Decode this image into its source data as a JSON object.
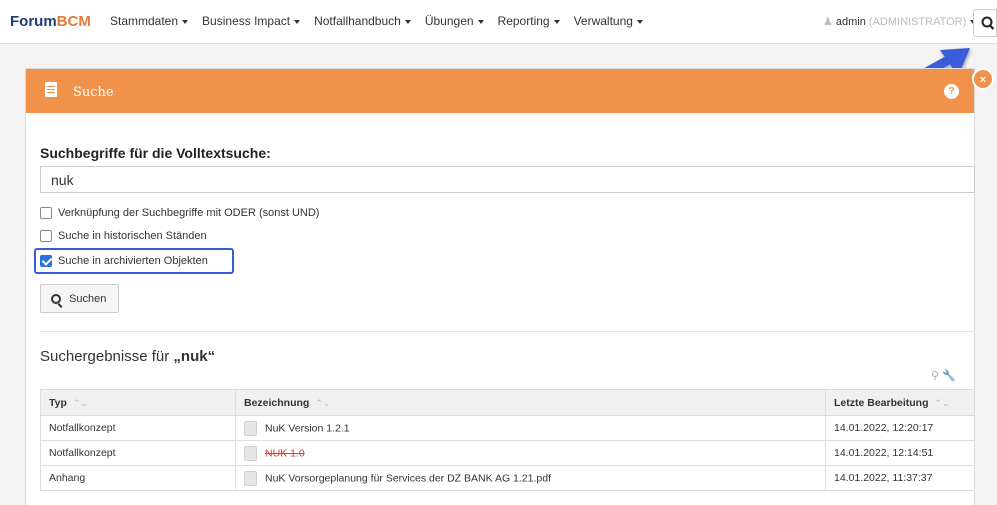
{
  "navbar": {
    "brand_part1": "Forum",
    "brand_part2": "BCM",
    "items": [
      {
        "label": "Stammdaten"
      },
      {
        "label": "Business Impact"
      },
      {
        "label": "Notfallhandbuch"
      },
      {
        "label": "Übungen"
      },
      {
        "label": "Reporting"
      },
      {
        "label": "Verwaltung"
      }
    ],
    "user_name": "admin",
    "user_role": "(ADMINISTRATOR)"
  },
  "panel": {
    "title": "Suche",
    "help": "?",
    "close": "×"
  },
  "form": {
    "heading": "Suchbegriffe für die Volltextsuche:",
    "query": "nuk",
    "options": [
      {
        "label": "Verknüpfung der Suchbegriffe mit ODER (sonst UND)",
        "checked": false
      },
      {
        "label": "Suche in historischen Ständen",
        "checked": false
      },
      {
        "label": "Suche in archivierten Objekten",
        "checked": true
      }
    ],
    "search_button": "Suchen"
  },
  "results": {
    "title_prefix": "Suchergebnisse für ",
    "title_query": "„nuk“",
    "columns": [
      "Typ",
      "Bezeichnung",
      "Letzte Bearbeitung"
    ],
    "rows": [
      {
        "typ": "Notfallkonzept",
        "bezeichnung": "NuK Version 1.2.1",
        "datum": "14.01.2022, 12:20:17",
        "archived": false
      },
      {
        "typ": "Notfallkonzept",
        "bezeichnung": "NUK 1.0",
        "datum": "14.01.2022, 12:14:51",
        "archived": true
      },
      {
        "typ": "Anhang",
        "bezeichnung": "NuK Vorsorgeplanung für Services der DZ BANK AG 1.21.pdf",
        "datum": "14.01.2022, 11:37:37",
        "archived": false
      }
    ]
  },
  "colors": {
    "accent": "#f0924a",
    "highlight": "#3a5bd9"
  }
}
